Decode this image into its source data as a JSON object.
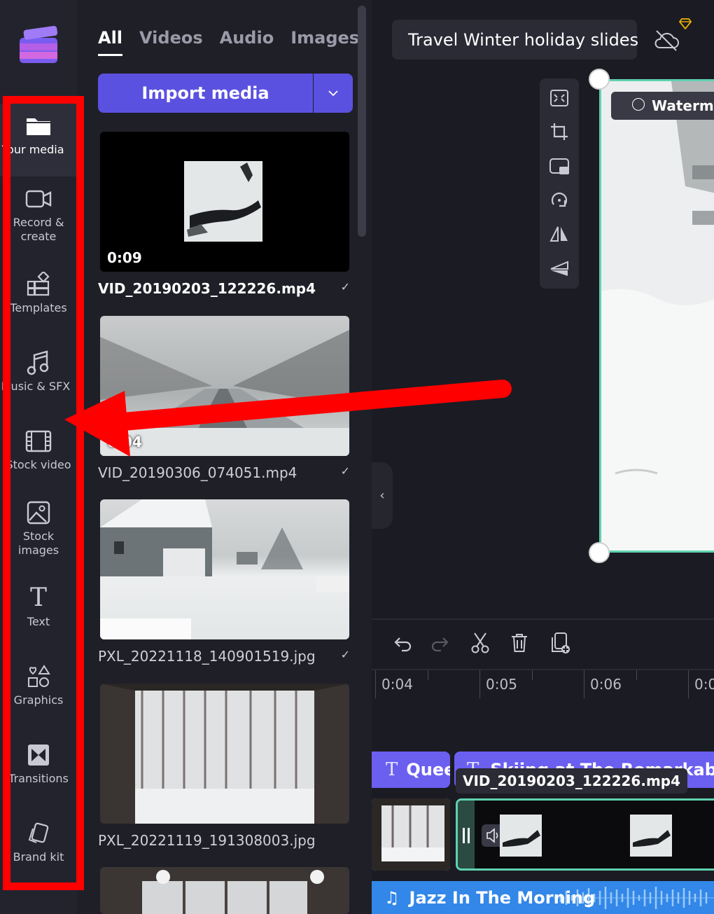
{
  "nav": {
    "items": [
      {
        "label": "Your media",
        "icon": "folder-icon"
      },
      {
        "label": "Record &\ncreate",
        "icon": "camera-icon"
      },
      {
        "label": "Templates",
        "icon": "templates-icon"
      },
      {
        "label": "Music & SFX",
        "icon": "music-icon"
      },
      {
        "label": "Stock video",
        "icon": "film-icon"
      },
      {
        "label": "Stock\nimages",
        "icon": "image-icon"
      },
      {
        "label": "Text",
        "icon": "text-icon"
      },
      {
        "label": "Graphics",
        "icon": "shapes-icon"
      },
      {
        "label": "Transitions",
        "icon": "transition-icon"
      },
      {
        "label": "Brand kit",
        "icon": "brand-kit-icon"
      }
    ]
  },
  "panel": {
    "tabs": [
      "All",
      "Videos",
      "Audio",
      "Images"
    ],
    "import_label": "Import media",
    "media": [
      {
        "name": "VID_20190203_122226.mp4",
        "duration": "0:09"
      },
      {
        "name": "VID_20190306_074051.mp4",
        "duration": "0:04"
      },
      {
        "name": "PXL_20221118_140901519.jpg",
        "duration": ""
      },
      {
        "name": "PXL_20221119_191308003.jpg",
        "duration": ""
      }
    ],
    "check": "✓"
  },
  "editor": {
    "project_title": "Travel Winter holiday slides",
    "watermark_label": "Watermar",
    "collapse_glyph": "‹"
  },
  "timeline": {
    "ticks": [
      "0:04",
      "0:05",
      "0:06",
      "0:0"
    ],
    "text_clips": [
      "Quee",
      "Skiing at The Remarkables"
    ],
    "video_tooltip": "VID_20190203_122226.mp4",
    "audio_clip": "Jazz In The Morning",
    "text_glyph": "T"
  },
  "colors": {
    "accent": "#5b51e0",
    "highlight_box": "#ff0000",
    "selection": "#5fd2b0",
    "audio": "#3287e8"
  }
}
